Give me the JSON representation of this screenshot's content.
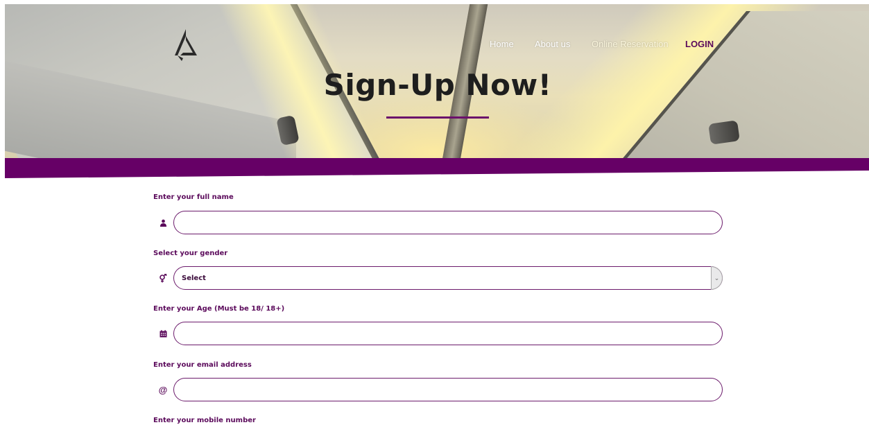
{
  "nav": {
    "items": [
      {
        "label": "Home"
      },
      {
        "label": "About us"
      },
      {
        "label": "Online Reservation"
      },
      {
        "label": "LOGIN"
      }
    ]
  },
  "hero": {
    "title": "Sign-Up Now!"
  },
  "form": {
    "fields": [
      {
        "label": "Enter your full name",
        "icon": "user-icon",
        "value": "",
        "placeholder": ""
      },
      {
        "label": "Select your gender",
        "icon": "gender-icon",
        "selected": "Select"
      },
      {
        "label": "Enter your Age (Must be 18/ 18+)",
        "icon": "calendar-icon",
        "value": "",
        "placeholder": ""
      },
      {
        "label": "Enter your email address",
        "icon": "at-sign-icon",
        "value": "",
        "placeholder": ""
      },
      {
        "label": "Enter your mobile number"
      }
    ]
  },
  "colors": {
    "accent": "#660066",
    "label": "#5b0a5b",
    "title": "#1e1e1e"
  }
}
